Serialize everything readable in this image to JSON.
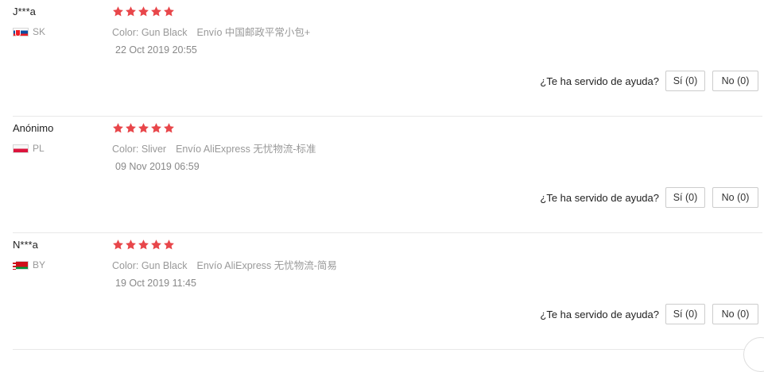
{
  "helpful_question": "¿Te ha servido de ayuda?",
  "reviews": [
    {
      "user": "J***a",
      "country_code": "SK",
      "flag": "slovakia-flag-icon",
      "rating": 5,
      "color": "Color: Gun Black",
      "shipping": "Envío 中国邮政平常小包+",
      "date": "22 Oct 2019 20:55",
      "yes_label": "Sí (0)",
      "no_label": "No (0)"
    },
    {
      "user": "Anónimo",
      "country_code": "PL",
      "flag": "poland-flag-icon",
      "rating": 5,
      "color": "Color: Sliver",
      "shipping": "Envío AliExpress 无忧物流-标准",
      "date": "09 Nov 2019 06:59",
      "yes_label": "Sí (0)",
      "no_label": "No (0)"
    },
    {
      "user": "N***a",
      "country_code": "BY",
      "flag": "belarus-flag-icon",
      "rating": 5,
      "color": "Color: Gun Black",
      "shipping": "Envío AliExpress 无忧物流-简易",
      "date": "19 Oct 2019 11:45",
      "yes_label": "Sí (0)",
      "no_label": "No (0)"
    }
  ],
  "colors": {
    "star": "#e8464a",
    "border": "#e8e8e8",
    "muted_text": "#999999"
  }
}
